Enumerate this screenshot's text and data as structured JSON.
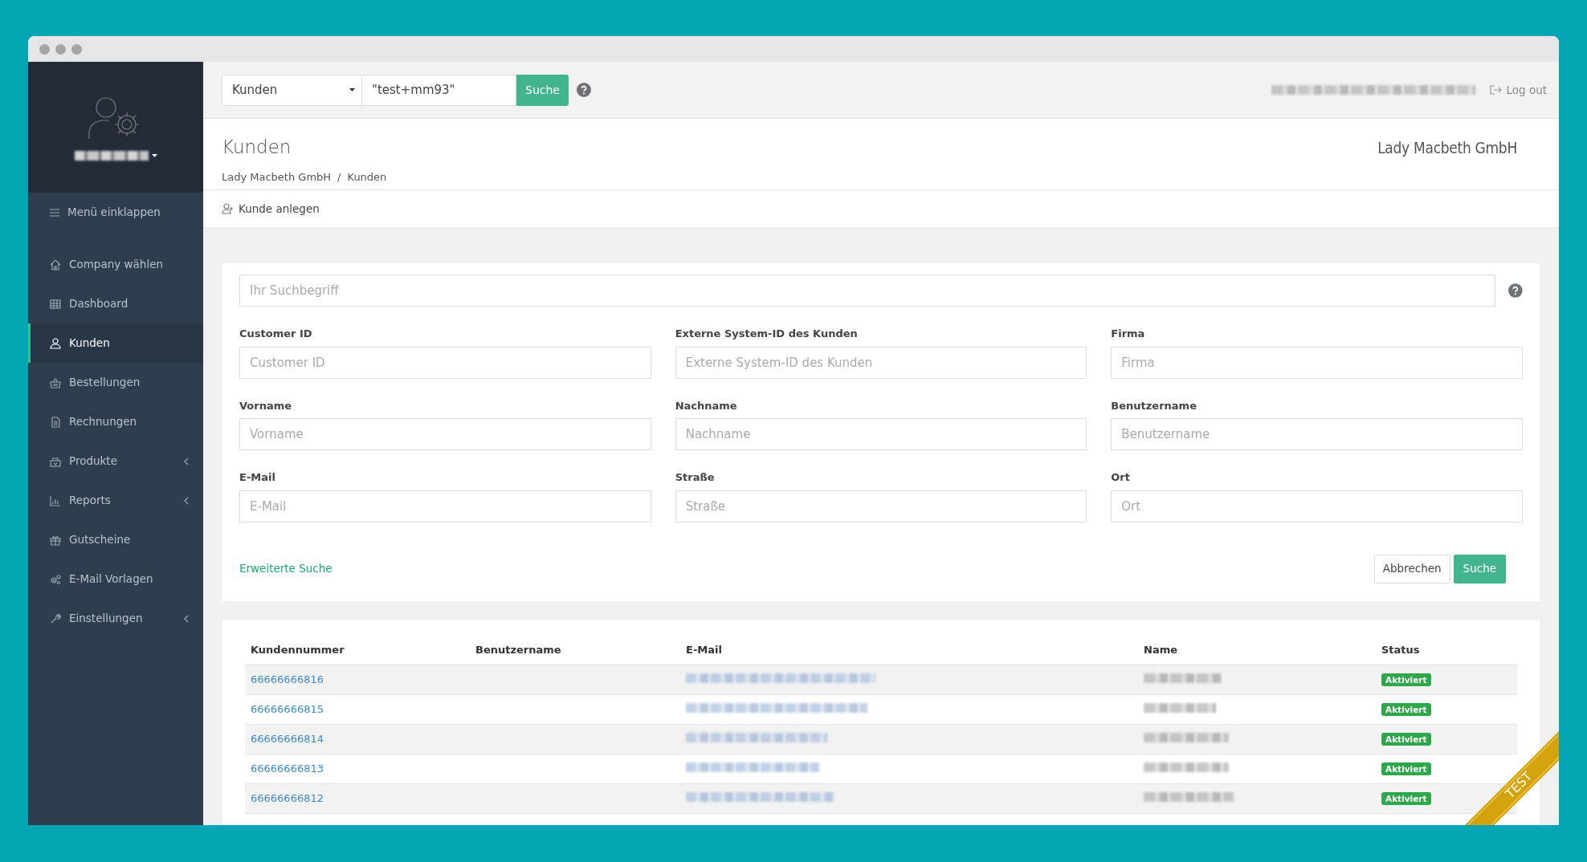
{
  "sidebar": {
    "collapse_label": "Menü einklappen",
    "items": [
      {
        "label": "Company wählen",
        "selected": false,
        "has_submenu": false
      },
      {
        "label": "Dashboard",
        "selected": false,
        "has_submenu": false
      },
      {
        "label": "Kunden",
        "selected": true,
        "has_submenu": false
      },
      {
        "label": "Bestellungen",
        "selected": false,
        "has_submenu": false
      },
      {
        "label": "Rechnungen",
        "selected": false,
        "has_submenu": false
      },
      {
        "label": "Produkte",
        "selected": false,
        "has_submenu": true
      },
      {
        "label": "Reports",
        "selected": false,
        "has_submenu": true
      },
      {
        "label": "Gutscheine",
        "selected": false,
        "has_submenu": false
      },
      {
        "label": "E-Mail Vorlagen",
        "selected": false,
        "has_submenu": false
      },
      {
        "label": "Einstellungen",
        "selected": false,
        "has_submenu": true
      }
    ]
  },
  "topbar": {
    "scope_select": "Kunden",
    "query": "\"test+mm93\"",
    "search_button": "Suche",
    "logout": "Log out"
  },
  "header": {
    "title": "Kunden",
    "company": "Lady Macbeth GmbH",
    "breadcrumb": [
      "Lady Macbeth GmbH",
      "Kunden"
    ],
    "breadcrumb_separator": "/"
  },
  "actions": [
    {
      "label": "Kunde anlegen"
    }
  ],
  "search_form": {
    "query_placeholder": "Ihr Suchbegriff",
    "fields": [
      {
        "label": "Customer ID",
        "placeholder": "Customer ID"
      },
      {
        "label": "Externe System-ID des Kunden",
        "placeholder": "Externe System-ID des Kunden"
      },
      {
        "label": "Firma",
        "placeholder": "Firma"
      },
      {
        "label": "Vorname",
        "placeholder": "Vorname"
      },
      {
        "label": "Nachname",
        "placeholder": "Nachname"
      },
      {
        "label": "Benutzername",
        "placeholder": "Benutzername"
      },
      {
        "label": "E-Mail",
        "placeholder": "E-Mail"
      },
      {
        "label": "Straße",
        "placeholder": "Straße"
      },
      {
        "label": "Ort",
        "placeholder": "Ort"
      }
    ],
    "advanced_link": "Erweiterte Suche",
    "buttons": [
      {
        "label": "Abbrechen",
        "kind": "secondary"
      },
      {
        "label": "Suche",
        "kind": "primary"
      }
    ]
  },
  "table": {
    "columns": [
      "Kundennummer",
      "Benutzername",
      "E-Mail",
      "Name",
      "Status"
    ],
    "rows": [
      {
        "customer_number": "66666666816",
        "status": "Aktiviert"
      },
      {
        "customer_number": "66666666815",
        "status": "Aktiviert"
      },
      {
        "customer_number": "66666666814",
        "status": "Aktiviert"
      },
      {
        "customer_number": "66666666813",
        "status": "Aktiviert"
      },
      {
        "customer_number": "66666666812",
        "status": "Aktiviert"
      }
    ]
  },
  "ribbon": "TEST"
}
